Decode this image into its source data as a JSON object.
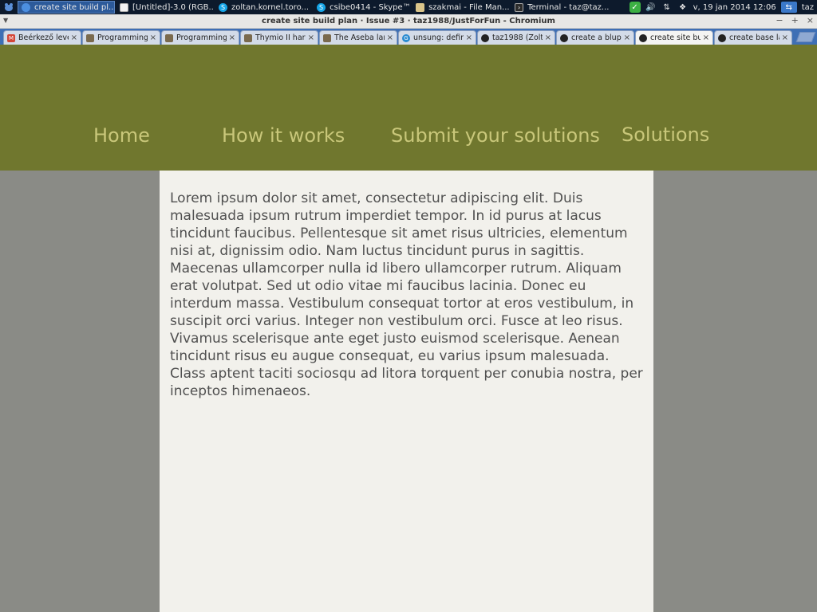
{
  "taskbar": {
    "tasks": [
      {
        "label": "create site build pl...",
        "icon": "chrome-icon"
      },
      {
        "label": "[Untitled]-3.0 (RGB...",
        "icon": "document-icon"
      },
      {
        "label": "zoltan.kornel.toro...",
        "icon": "skype-icon"
      },
      {
        "label": "csibe0414 - Skype™",
        "icon": "skype-icon"
      },
      {
        "label": "szakmai - File Man...",
        "icon": "folder-icon"
      },
      {
        "label": "Terminal - taz@taz...",
        "icon": "terminal-icon"
      }
    ],
    "clock": "v, 19 jan 2014 12:06",
    "user": "taz"
  },
  "window": {
    "title": "create site build plan · Issue #3 · taz1988/JustForFun - Chromium"
  },
  "tabs": [
    {
      "label": "Beérkező leve",
      "icon": "gmail-icon"
    },
    {
      "label": "Programming",
      "icon": "book-icon"
    },
    {
      "label": "Programming",
      "icon": "book-icon"
    },
    {
      "label": "Thymio II har",
      "icon": "book-icon"
    },
    {
      "label": "The Aseba lar",
      "icon": "book-icon"
    },
    {
      "label": "unsung: defir",
      "icon": "g-icon"
    },
    {
      "label": "taz1988 (Zolt",
      "icon": "github-icon"
    },
    {
      "label": "create a blup",
      "icon": "github-icon"
    },
    {
      "label": "create site bu",
      "icon": "github-icon",
      "active": true
    },
    {
      "label": "create base la",
      "icon": "github-icon"
    }
  ],
  "nav": {
    "home": "Home",
    "how_it_works": "How it works",
    "submit": "Submit your solutions",
    "solutions": "Solutions"
  },
  "content": {
    "text": "Lorem ipsum dolor sit amet, consectetur adipiscing elit. Duis malesuada ipsum rutrum imperdiet tempor. In id purus at lacus tincidunt faucibus. Pellentesque sit amet risus ultricies, elementum nisi at, dignissim odio. Nam luctus tincidunt purus in sagittis. Maecenas ullamcorper nulla id libero ullamcorper rutrum. Aliquam erat volutpat. Sed ut odio vitae mi faucibus lacinia. Donec eu interdum massa. Vestibulum consequat tortor at eros vestibulum, in suscipit orci varius. Integer non vestibulum orci. Fusce at leo risus. Vivamus scelerisque ante eget justo euismod scelerisque. Aenean tincidunt risus eu augue consequat, eu varius ipsum malesuada. Class aptent taciti sociosqu ad litora torquent per conubia nostra, per inceptos himenaeos."
  },
  "colors": {
    "header_bg": "#70772e",
    "nav_text": "#c9c77a",
    "page_bg": "#8a8b86",
    "content_bg": "#f2f1ec"
  }
}
